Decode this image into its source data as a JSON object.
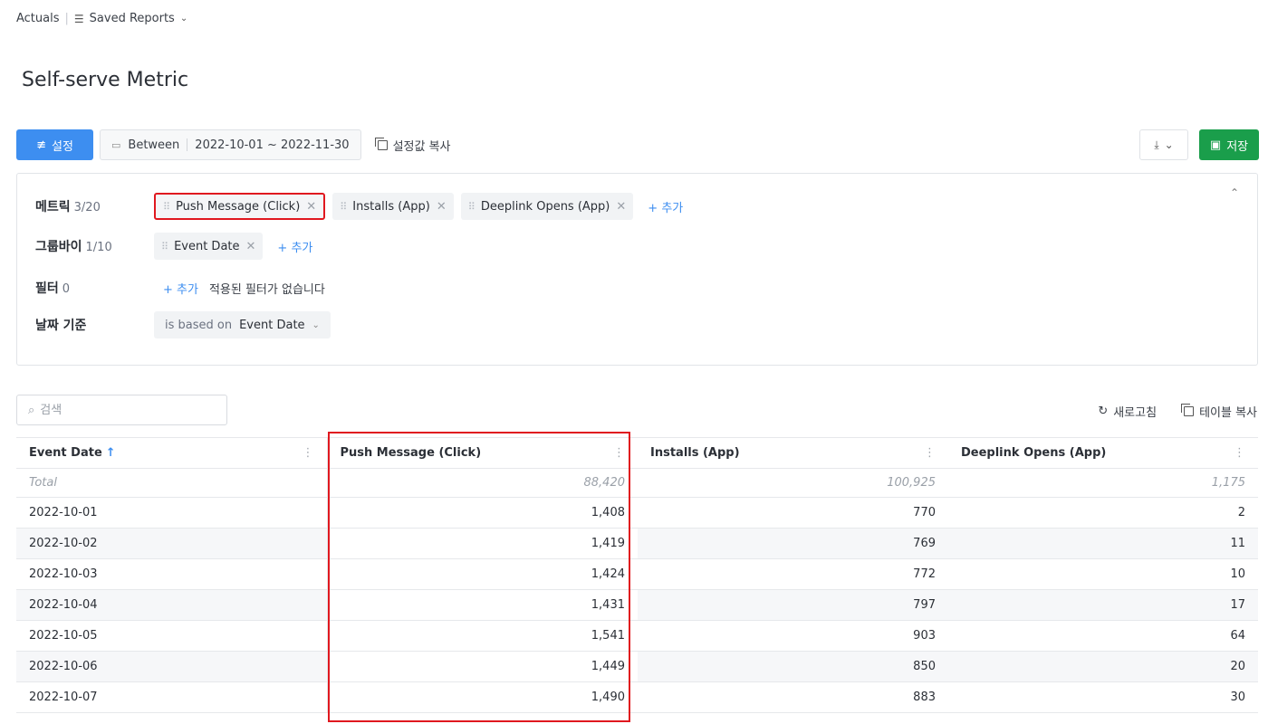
{
  "breadcrumb": {
    "root": "Actuals",
    "separator": "|",
    "saved_reports": "Saved Reports"
  },
  "page_title": "Self-serve Metric",
  "toolbar": {
    "settings_label": "설정",
    "date_prefix": "Between",
    "date_range": "2022-10-01 ~ 2022-11-30",
    "copy_settings_label": "설정값 복사",
    "save_label": "저장"
  },
  "config": {
    "metric": {
      "label": "메트릭",
      "count": "3/20",
      "chips": [
        "Push Message (Click)",
        "Installs (App)",
        "Deeplink Opens (App)"
      ],
      "add_label": "+ 추가"
    },
    "groupby": {
      "label": "그룹바이",
      "count": "1/10",
      "chips": [
        "Event Date"
      ],
      "add_label": "+ 추가"
    },
    "filter": {
      "label": "필터",
      "count": "0",
      "add_label": "+ 추가",
      "empty_note": "적용된 필터가 없습니다"
    },
    "date_basis": {
      "label": "날짜 기준",
      "prefix": "is based on",
      "value": "Event Date"
    }
  },
  "table_controls": {
    "search_placeholder": "검색",
    "refresh_label": "새로고침",
    "copy_table_label": "테이블 복사"
  },
  "table": {
    "columns": [
      "Event Date",
      "Push Message (Click)",
      "Installs (App)",
      "Deeplink Opens (App)"
    ],
    "sort_indicator": "↑",
    "total": {
      "label": "Total",
      "values": [
        "88,420",
        "100,925",
        "1,175"
      ]
    },
    "rows": [
      {
        "date": "2022-10-01",
        "values": [
          "1,408",
          "770",
          "2"
        ]
      },
      {
        "date": "2022-10-02",
        "values": [
          "1,419",
          "769",
          "11"
        ]
      },
      {
        "date": "2022-10-03",
        "values": [
          "1,424",
          "772",
          "10"
        ]
      },
      {
        "date": "2022-10-04",
        "values": [
          "1,431",
          "797",
          "17"
        ]
      },
      {
        "date": "2022-10-05",
        "values": [
          "1,541",
          "903",
          "64"
        ]
      },
      {
        "date": "2022-10-06",
        "values": [
          "1,449",
          "850",
          "20"
        ]
      },
      {
        "date": "2022-10-07",
        "values": [
          "1,490",
          "883",
          "30"
        ]
      }
    ]
  },
  "colors": {
    "primary": "#3d8ef0",
    "save": "#1a9e4b",
    "highlight": "#e0181f"
  }
}
